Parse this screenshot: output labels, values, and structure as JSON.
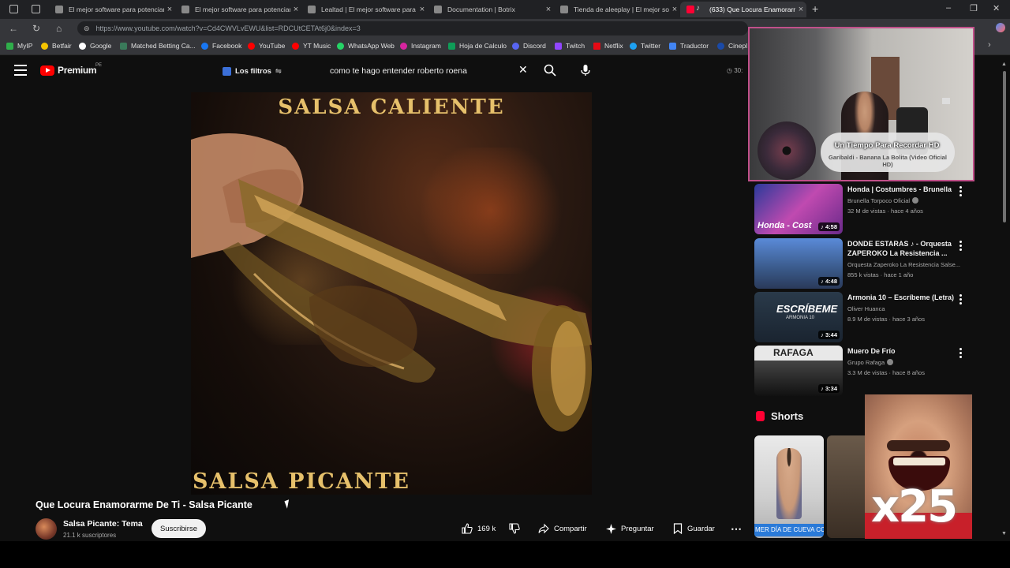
{
  "browser": {
    "tabs": [
      {
        "label": "El mejor software para potenciar",
        "active": false
      },
      {
        "label": "El mejor software para potenciar",
        "active": false
      },
      {
        "label": "Lealtad | El mejor software para p",
        "active": false
      },
      {
        "label": "Documentation | Botrix",
        "active": false
      },
      {
        "label": "Tienda de aleeplay | El mejor softw",
        "active": false
      },
      {
        "label": "(633) Que Locura Enamorarme",
        "active": true
      }
    ],
    "url": "https://www.youtube.com/watch?v=Cd4CWVLvEWU&list=RDCUtCETAt6j0&index=3",
    "bookmarks": [
      "MyIP",
      "Betfair",
      "Google",
      "Matched Betting Ca...",
      "Facebook",
      "YouTube",
      "YT Music",
      "WhatsApp Web",
      "Instagram",
      "Hoja de Calculo",
      "Discord",
      "Twitch",
      "Netflix",
      "Twitter",
      "Traductor",
      "Cinepl"
    ]
  },
  "header": {
    "logo_text": "Premium",
    "logo_region": "PE",
    "filters_label": "Los filtros",
    "search_query": "como te hago entender roberto roena",
    "counter": "30:"
  },
  "video": {
    "top_text": "SALSA CALIENTE",
    "bottom_text": "SALSA PICANTE",
    "title": "Que Locura Enamorarme De Ti - Salsa Picante",
    "channel": "Salsa Picante: Tema",
    "subscribers": "21.1 k suscriptores",
    "subscribe_label": "Suscribirse",
    "likes": "169 k",
    "share_label": "Compartir",
    "ask_label": "Preguntar",
    "save_label": "Guardar"
  },
  "webcam": {
    "now_playing_title": "Un Tiempo Para Recordar HD",
    "now_playing_artist": "Garibaldi - Banana La Bolita (Video Oficial HD)"
  },
  "recommendations": [
    {
      "title": "Honda | Costumbres - Brunella",
      "channel": "Brunella Torpoco Oficial",
      "meta": "32 M de vistas · hace 4 años",
      "duration": "4:58"
    },
    {
      "title": "DONDE ESTARAS ♪ - Orquesta ZAPEROKO La Resistencia ...",
      "channel": "Orquesta Zaperoko La Resistencia Salse...",
      "meta": "855 k vistas · hace 1 año",
      "duration": "4:48"
    },
    {
      "title": "Armonia 10 – Escríbeme (Letra)",
      "channel": "Oliver Huanca",
      "meta": "8.9 M de vistas · hace 3 años",
      "duration": "3:44"
    },
    {
      "title": "Muero De Frío",
      "channel": "Grupo Rafaga",
      "meta": "3.3 M de vistas · hace 8 años",
      "duration": "3:34"
    }
  ],
  "thumb_texts": [
    "Honda - Cost",
    "ESCRÍBEME",
    "ARMONIA 10",
    "RAFAGA"
  ],
  "shorts": {
    "title": "Shorts",
    "first_caption": "MER DÍA DE CUEVA CC"
  },
  "meme_text": "x25"
}
